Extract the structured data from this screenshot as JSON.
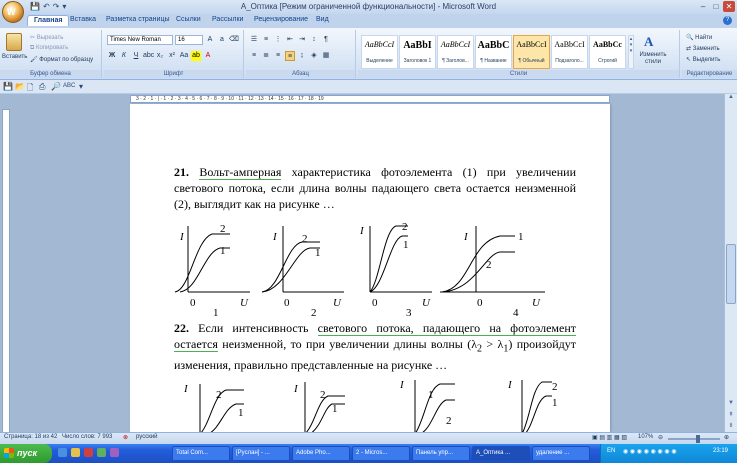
{
  "app": {
    "title": "А_Оптика [Режим ограниченной функциональности] - Microsoft Word",
    "office_button_label": "W"
  },
  "tabs": [
    {
      "label": "Главная"
    },
    {
      "label": "Вставка"
    },
    {
      "label": "Разметка страницы"
    },
    {
      "label": "Ссылки"
    },
    {
      "label": "Рассылки"
    },
    {
      "label": "Рецензирование"
    },
    {
      "label": "Вид"
    }
  ],
  "ribbon": {
    "clipboard": {
      "paste": "Вставить",
      "cut": "Вырезать",
      "copy": "Копировать",
      "format_painter": "Формат по образцу",
      "label": "Буфер обмена"
    },
    "font": {
      "font_name": "Times New Roman",
      "font_size": "16",
      "label": "Шрифт"
    },
    "paragraph": {
      "label": "Абзац"
    },
    "styles": {
      "items": [
        {
          "sample": "AaBbCcI",
          "name": "Выделение"
        },
        {
          "sample": "AaBbI",
          "name": "Заголовок 1"
        },
        {
          "sample": "AaBbCcI",
          "name": "¶ Заголов..."
        },
        {
          "sample": "AaBbC",
          "name": "¶ Название"
        },
        {
          "sample": "AaBbCcI",
          "name": "¶ Обычный"
        },
        {
          "sample": "AaBbCcI",
          "name": "Подзаголо..."
        },
        {
          "sample": "AaBbCc",
          "name": "Строгий"
        }
      ],
      "change_styles": "Изменить стили",
      "label": "Стили"
    },
    "editing": {
      "find": "Найти",
      "replace": "Заменить",
      "select": "Выделить",
      "label": "Редактирование"
    }
  },
  "ruler": {
    "numbers": "3 · 2 · 1 · | · 1 · 2 · 3 · 4 · 5 · 6 · 7 · 8 · 9 · 10 · 11 · 12 · 13 · 14 · 15 · 16 · 17 · 18 · 19"
  },
  "document": {
    "q21": {
      "number": "21.",
      "text_a": "Вольт-амперная",
      "text_b": " характеристика фотоэлемента (1) при увеличении светового потока, если длина волны падающего света остается неизменной (2), выглядит как на рисунке …"
    },
    "q21_graphs": [
      {
        "number": "1",
        "axis_y": "I",
        "axis_x": "U",
        "origin": "0",
        "curve_a": "2",
        "curve_b": "1"
      },
      {
        "number": "2",
        "axis_y": "I",
        "axis_x": "U",
        "origin": "0",
        "curve_a": "2",
        "curve_b": "1"
      },
      {
        "number": "3",
        "axis_y": "I",
        "axis_x": "U",
        "origin": "0",
        "curve_a": "2",
        "curve_b": "1"
      },
      {
        "number": "4",
        "axis_y": "I",
        "axis_x": "U",
        "origin": "0",
        "curve_a": "1",
        "curve_b": "2"
      }
    ],
    "q22": {
      "number": "22.",
      "text_a": " Если интенсивность ",
      "text_b": "светового потока, падающего на фотоэлемент остается",
      "text_c": " неизменной, то при увеличении длины волны (λ",
      "sub2": "2",
      "text_d": " > λ",
      "sub1": "1",
      "text_e": ") произойдут изменения, правильно представленные на рисунке …"
    },
    "q22_graphs": [
      {
        "axis_y": "I",
        "curve_a": "2",
        "curve_b": "1"
      },
      {
        "axis_y": "I",
        "curve_a": "2",
        "curve_b": "1"
      },
      {
        "axis_y": "I",
        "curve_a": "1",
        "curve_b": "2"
      },
      {
        "axis_y": "I",
        "curve_a": "2",
        "curve_b": "1"
      }
    ]
  },
  "statusbar": {
    "page": "Страница: 18 из 42",
    "words": "Число слов: 7 993",
    "language": "русский",
    "zoom": "107%"
  },
  "taskbar": {
    "start": "пуск",
    "buttons": [
      {
        "label": "Total Com..."
      },
      {
        "label": "[Руслан] - ..."
      },
      {
        "label": "Adobe Pho..."
      },
      {
        "label": "2 - Micros..."
      },
      {
        "label": "Панель упр..."
      },
      {
        "label": "А_Оптика ..."
      },
      {
        "label": "удаление ..."
      }
    ],
    "lang": "EN",
    "clock": "23:19"
  }
}
